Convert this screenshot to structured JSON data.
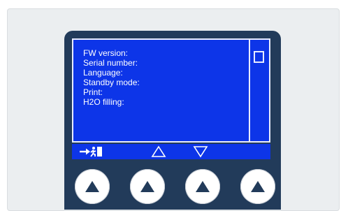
{
  "menu": {
    "items": [
      "FW version:",
      "Serial number:",
      "Language:",
      "Standby mode:",
      "Print:",
      "H2O filling:"
    ]
  },
  "softkeys": {
    "exit_icon": "exit-arrow-icon",
    "up_icon": "triangle-up-outline-icon",
    "down_icon": "triangle-down-outline-icon"
  },
  "hardware_buttons": {
    "count": 4,
    "icon": "triangle-up-filled-icon"
  },
  "colors": {
    "screen_blue": "#0d35e8",
    "device_navy": "#223b5a",
    "screen_text": "#ffffff"
  }
}
